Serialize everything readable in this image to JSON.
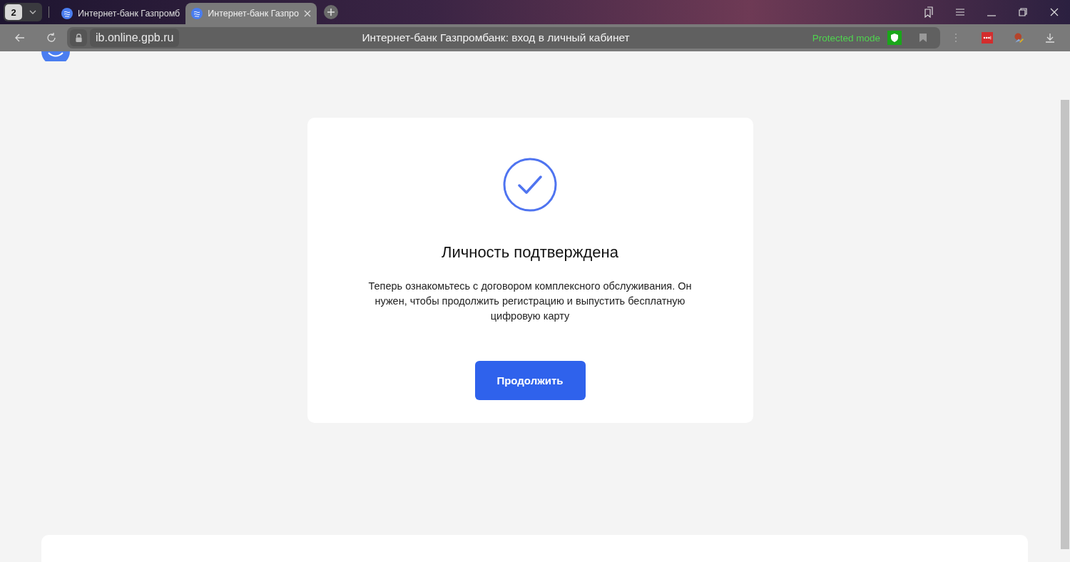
{
  "browser": {
    "tab_count": "2",
    "tabs": [
      {
        "title": "Интернет-банк Газпромб",
        "selected": false
      },
      {
        "title": "Интернет-банк Газпро",
        "selected": true
      }
    ],
    "address": "ib.online.gpb.ru",
    "page_title": "Интернет-банк Газпромбанк: вход в личный кабинет",
    "protected_mode": "Protected mode"
  },
  "card": {
    "title": "Личность подтверждена",
    "text": "Теперь ознакомьтесь с договором комплексного обслуживания. Он нужен, чтобы продолжить регистрацию и выпустить бесплатную цифровую карту",
    "button": "Продолжить"
  }
}
